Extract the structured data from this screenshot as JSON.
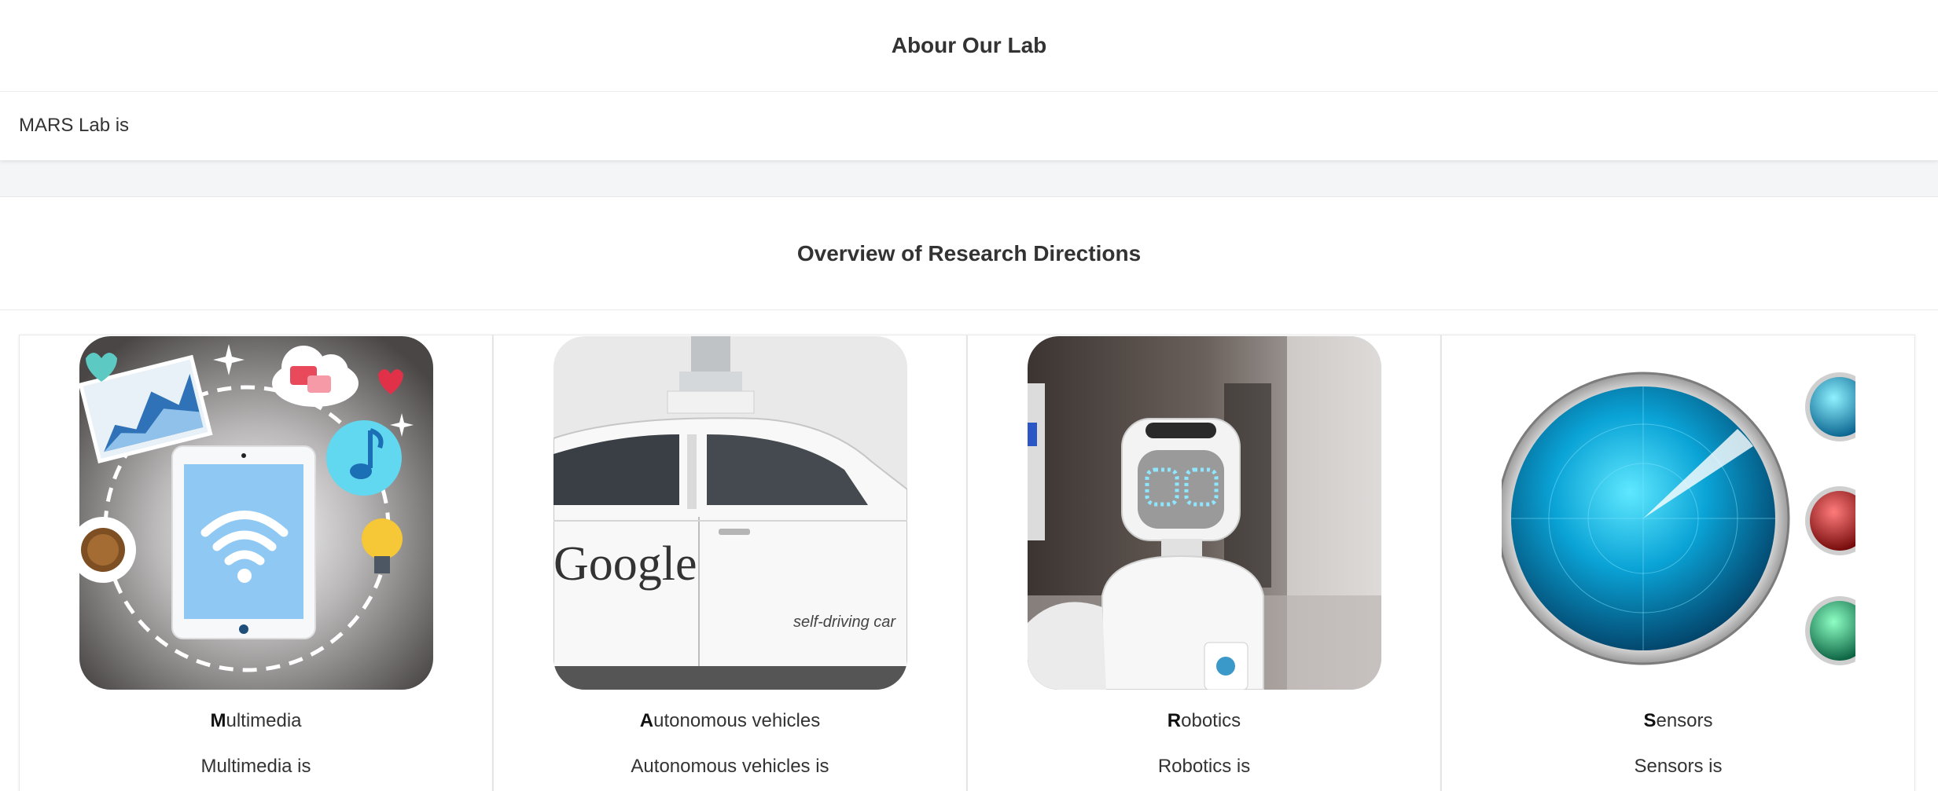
{
  "about": {
    "title": "Abour Our Lab",
    "text": "MARS Lab is"
  },
  "research": {
    "title": "Overview of Research Directions",
    "cards": [
      {
        "initial": "M",
        "rest": "ultimedia",
        "desc": "Multimedia is",
        "image_icon": "multimedia-illustration"
      },
      {
        "initial": "A",
        "rest": "utonomous vehicles",
        "desc": "Autonomous vehicles is",
        "image_icon": "self-driving-car-photo",
        "image_text": [
          "Google",
          "self-driving car"
        ]
      },
      {
        "initial": "R",
        "rest": "obotics",
        "desc": "Robotics is",
        "image_icon": "robot-photo"
      },
      {
        "initial": "S",
        "rest": "ensors",
        "desc": "Sensors is",
        "image_icon": "radar-sensor-illustration"
      }
    ]
  }
}
